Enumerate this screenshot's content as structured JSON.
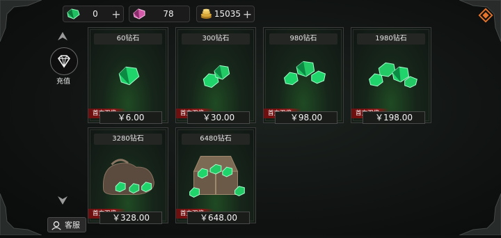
{
  "currencies": [
    {
      "id": "green",
      "value": "0",
      "has_plus": true
    },
    {
      "id": "pink",
      "value": "78",
      "has_plus": false
    },
    {
      "id": "gold",
      "value": "15035",
      "has_plus": true
    }
  ],
  "sidebar": {
    "recharge_label": "充值",
    "service_label": "客服"
  },
  "products": [
    {
      "title": "60钻石",
      "badge": "首充双倍",
      "price": "￥6.00"
    },
    {
      "title": "300钻石",
      "badge": "首充双倍",
      "price": "￥30.00"
    },
    {
      "title": "980钻石",
      "badge": "首充双倍",
      "price": "￥98.00"
    },
    {
      "title": "1980钻石",
      "badge": "首充双倍",
      "price": "￥198.00"
    },
    {
      "title": "3280钻石",
      "badge": "首充双倍",
      "price": "￥328.00"
    },
    {
      "title": "6480钻石",
      "badge": "首充双倍",
      "price": "￥648.00"
    }
  ],
  "colors": {
    "gem_green": "#1fd46a",
    "badge_red": "#8e1515",
    "accent_orange": "#e8742c"
  }
}
